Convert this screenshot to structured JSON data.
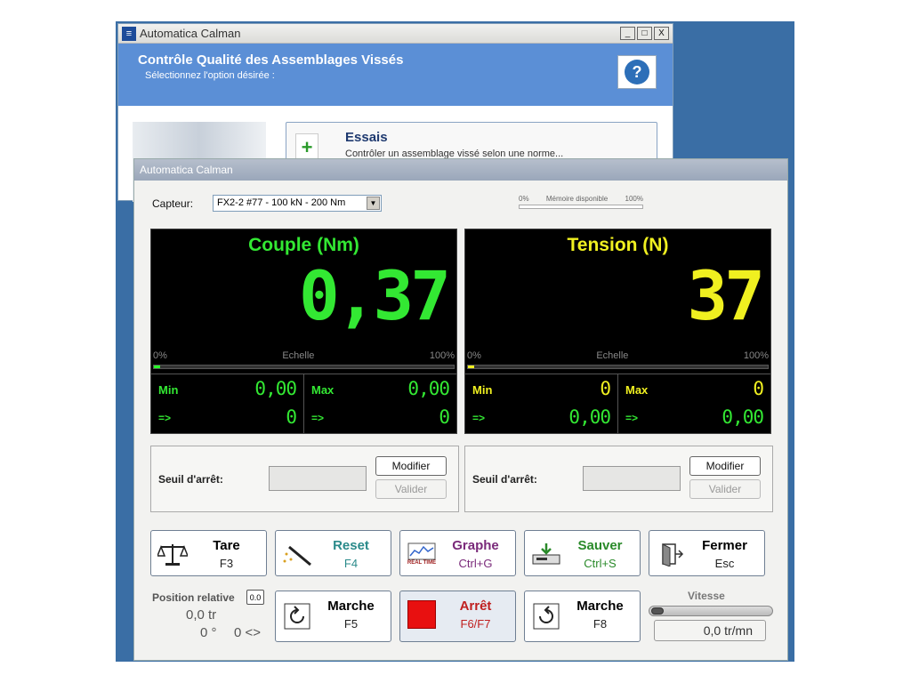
{
  "back_window": {
    "title": "Automatica Calman",
    "header_title": "Contrôle Qualité des Assemblages Vissés",
    "header_subtitle": "Sélectionnez l'option désirée :",
    "help_label": "?",
    "minimize": "_",
    "maximize": "□",
    "close": "X",
    "essais": {
      "title": "Essais",
      "description": "Contrôler un assemblage vissé selon une norme...",
      "icon_glyph": "+"
    }
  },
  "front_window": {
    "title": "Automatica Calman",
    "capteur_label": "Capteur:",
    "capteur_value": "FX2-2 #77 - 100 kN - 200 Nm",
    "memory": {
      "min": "0%",
      "label": "Mémoire disponible",
      "max": "100%"
    },
    "couple": {
      "title": "Couple (Nm)",
      "value": "0,37",
      "scale_min": "0%",
      "scale_label": "Echelle",
      "scale_max": "100%",
      "scale_fraction": 0.02,
      "min_label": "Min",
      "min_value": "0,00",
      "max_label": "Max",
      "max_value": "0,00",
      "arrow": "=>",
      "min_arrow_value": "0",
      "max_arrow_value": "0",
      "color": "#33e833"
    },
    "tension": {
      "title": "Tension (N)",
      "value": "37",
      "scale_min": "0%",
      "scale_label": "Echelle",
      "scale_max": "100%",
      "scale_fraction": 0.02,
      "min_label": "Min",
      "min_value": "0",
      "max_label": "Max",
      "max_value": "0",
      "arrow": "=>",
      "min_arrow_value": "0,00",
      "max_arrow_value": "0,00",
      "color": "#f0f020"
    },
    "seuil": {
      "label": "Seuil d'arrêt:",
      "modifier": "Modifier",
      "valider": "Valider"
    },
    "buttons": {
      "tare": {
        "title": "Tare",
        "key": "F3",
        "color": "#222222"
      },
      "reset": {
        "title": "Reset",
        "key": "F4",
        "color": "#2a8a8a"
      },
      "graphe": {
        "title": "Graphe",
        "key": "Ctrl+G",
        "color": "#7a2a7a",
        "icon_caption": "REAL TIME"
      },
      "sauver": {
        "title": "Sauver",
        "key": "Ctrl+S",
        "color": "#2a8a2a"
      },
      "fermer": {
        "title": "Fermer",
        "key": "Esc",
        "color": "#222222"
      },
      "marche_left": {
        "title": "Marche",
        "key": "F5",
        "color": "#222222"
      },
      "arret": {
        "title": "Arrêt",
        "key": "F6/F7",
        "color": "#c02020"
      },
      "marche_right": {
        "title": "Marche",
        "key": "F8",
        "color": "#222222"
      }
    },
    "position": {
      "title": "Position relative",
      "zero_btn": "0.0",
      "turns": "0,0 tr",
      "degrees": "0 °",
      "arrows": "0 <>"
    },
    "vitesse": {
      "label": "Vitesse",
      "value": "0,0 tr/mn",
      "slider_fraction": 0.0
    }
  }
}
